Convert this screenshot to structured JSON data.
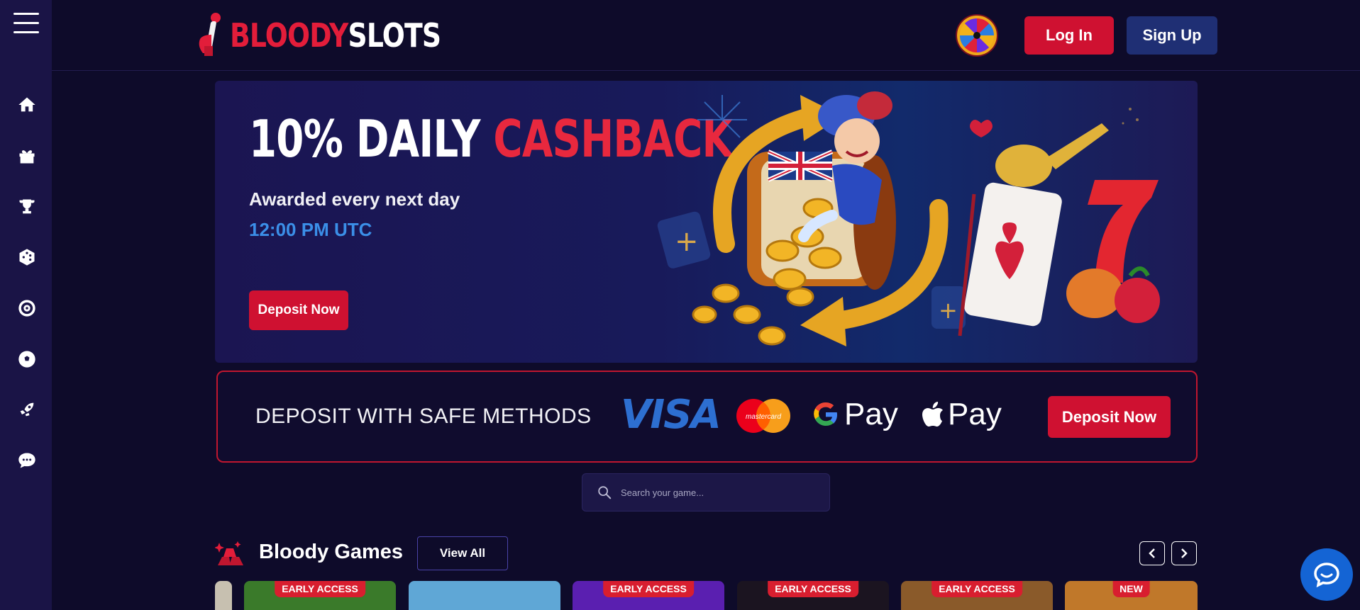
{
  "header": {
    "logo_red": "BLOODY",
    "logo_white": "SLOTS",
    "login_label": "Log In",
    "signup_label": "Sign Up"
  },
  "sidebar": {
    "items": [
      {
        "icon": "home-icon"
      },
      {
        "icon": "gift-icon"
      },
      {
        "icon": "trophy-icon"
      },
      {
        "icon": "dice-icon"
      },
      {
        "icon": "roulette-icon"
      },
      {
        "icon": "soccer-ball-icon"
      },
      {
        "icon": "rocket-icon"
      },
      {
        "icon": "chat-bubble-icon"
      }
    ]
  },
  "hero": {
    "title_white": "10% DAILY ",
    "title_red": "CASHBACK",
    "subtitle": "Awarded every next day",
    "time": "12:00 PM UTC",
    "button_label": "Deposit Now"
  },
  "deposit": {
    "text": "DEPOSIT WITH SAFE METHODS",
    "visa": "VISA",
    "mastercard": "mastercard",
    "gpay": "Pay",
    "applepay": "Pay",
    "button_label": "Deposit Now"
  },
  "search": {
    "placeholder": "Search your game..."
  },
  "section": {
    "title": "Bloody Games",
    "view_all": "View All"
  },
  "games": [
    {
      "badge": "EARLY ACCESS",
      "color": "#3a7a2a"
    },
    {
      "badge": "",
      "color": "#5fa7d6"
    },
    {
      "badge": "EARLY ACCESS",
      "color": "#5a1fb0"
    },
    {
      "badge": "EARLY ACCESS",
      "color": "#1b1420"
    },
    {
      "badge": "EARLY ACCESS",
      "color": "#8a5a2a"
    },
    {
      "badge": "NEW",
      "color": "#c0782a"
    }
  ],
  "colors": {
    "accent_red": "#cf1131",
    "signup_blue": "#1f2f74",
    "time_blue": "#3b8fe8",
    "background": "#0e0b2a"
  }
}
